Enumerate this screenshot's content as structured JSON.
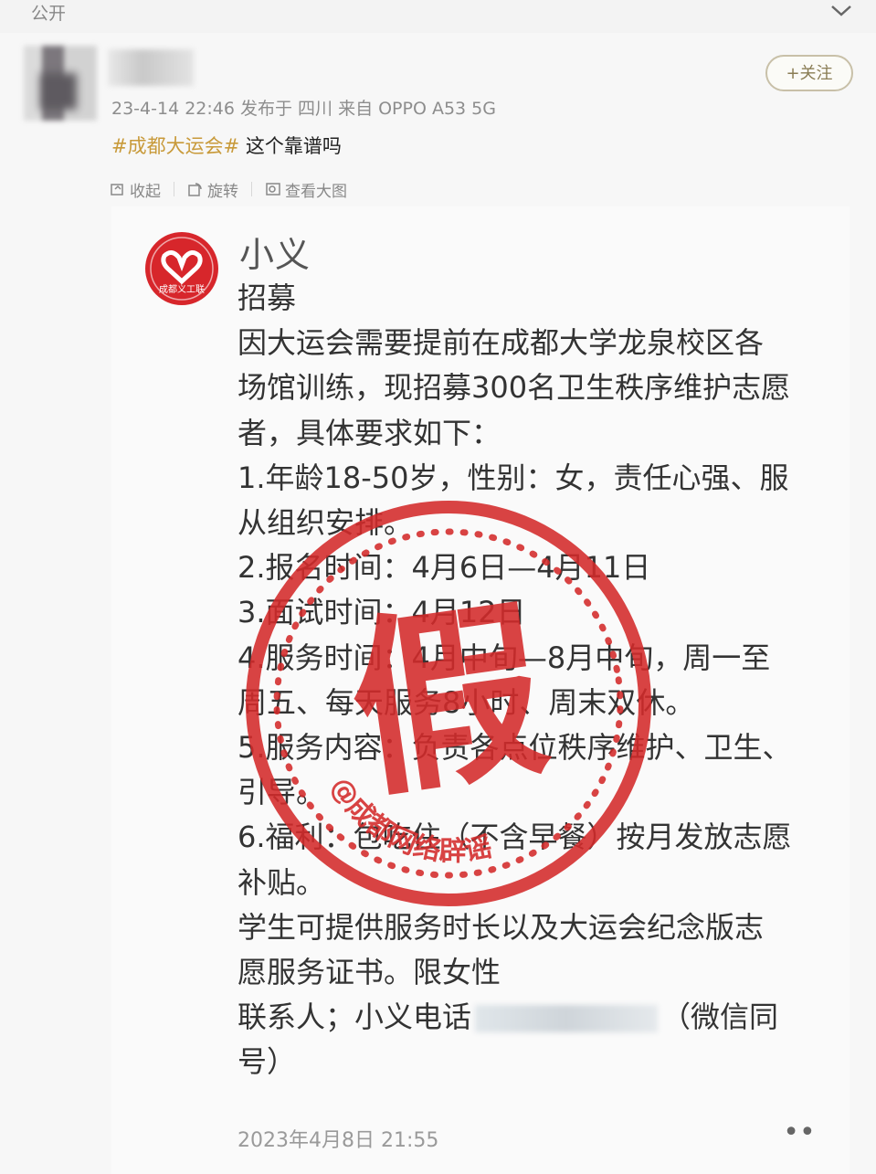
{
  "topbar": {
    "visibility": "公开"
  },
  "post": {
    "follow_label": "+关注",
    "meta": "23-4-14 22:46 发布于 四川 来自 OPPO A53 5G",
    "hashtag": "#成都大运会#",
    "text": " 这个靠谱吗",
    "toolbar": {
      "collapse": "收起",
      "rotate": "旋转",
      "view_large": "查看大图"
    }
  },
  "card": {
    "org_name": "小义",
    "logo_text": "成都义工联",
    "lines": [
      "招募",
      "因大运会需要提前在成都大学龙泉校区各",
      "场馆训练，现招募300名卫生秩序维护志愿",
      "者，具体要求如下：",
      "1.年龄18-50岁，性别：女，责任心强、服",
      "从组织安排。",
      "2.报名时间：4月6日—4月11日",
      "3.面试时间：4月12日",
      "4.服务时间：4月中旬—8月中旬，周一至",
      "周五、每天服务8小时、周末双休。",
      "5.服务内容：负责各点位秩序维护、卫生、",
      "引导。",
      "6.福利：包吃住（不含早餐）按月发放志愿",
      "补贴。",
      "学生可提供服务时长以及大运会纪念版志",
      "愿服务证书。限女性"
    ],
    "contact_prefix": "联系人；小义电话",
    "contact_suffix": "（微信同",
    "contact_tail": "号）",
    "timestamp": "2023年4月8日 21:55",
    "more": "••"
  },
  "stamp": {
    "big_char": "假",
    "arc_text": "@成都网络辟谣",
    "color": "#d42a2a"
  },
  "colors": {
    "hashtag": "#c89a3a",
    "stamp": "#d42a2a",
    "logo": "#d7262b"
  }
}
